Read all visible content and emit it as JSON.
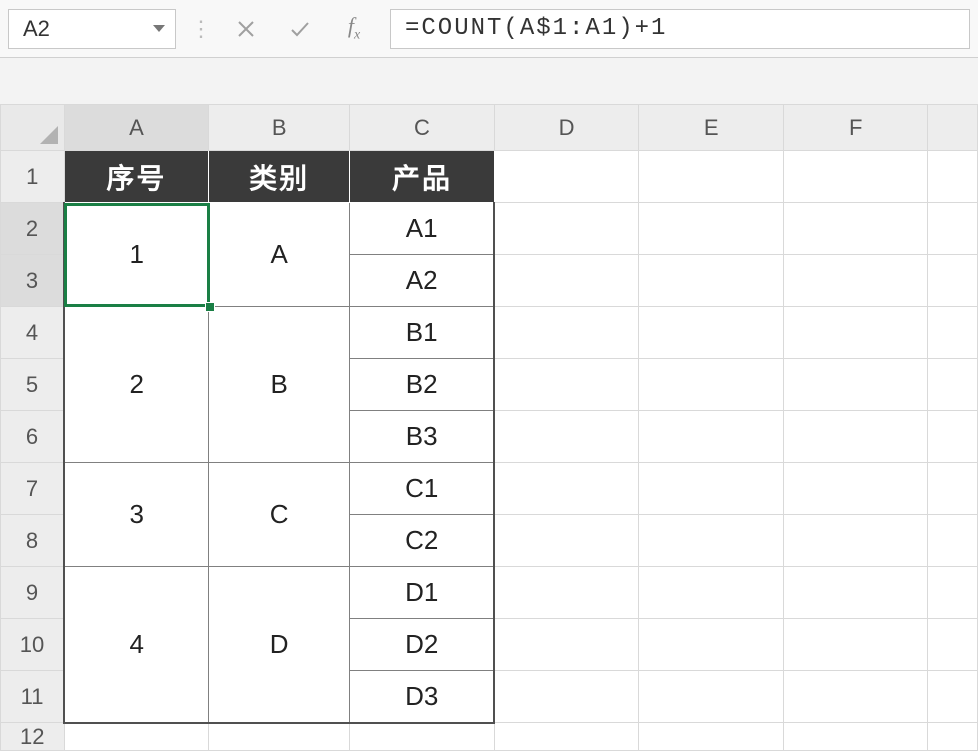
{
  "nameBox": {
    "value": "A2"
  },
  "formulaBar": {
    "formula": "=COUNT(A$1:A1)+1"
  },
  "columns": [
    "A",
    "B",
    "C",
    "D",
    "E",
    "F"
  ],
  "rows": [
    "1",
    "2",
    "3",
    "4",
    "5",
    "6",
    "7",
    "8",
    "9",
    "10",
    "11",
    "12"
  ],
  "tableHeader": {
    "col1": "序号",
    "col2": "类别",
    "col3": "产品"
  },
  "groups": [
    {
      "seq": "1",
      "category": "A",
      "products": [
        "A1",
        "A2"
      ]
    },
    {
      "seq": "2",
      "category": "B",
      "products": [
        "B1",
        "B2",
        "B3"
      ]
    },
    {
      "seq": "3",
      "category": "C",
      "products": [
        "C1",
        "C2"
      ]
    },
    {
      "seq": "4",
      "category": "D",
      "products": [
        "D1",
        "D2",
        "D3"
      ]
    }
  ],
  "activeCell": "A2",
  "colors": {
    "accent": "#1a7f45",
    "headerDark": "#3a3a3a"
  }
}
